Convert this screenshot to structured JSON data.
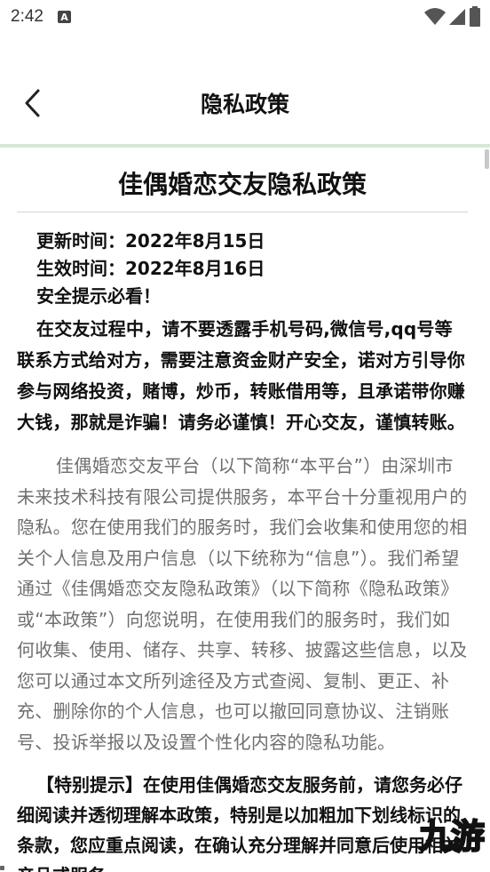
{
  "status_bar": {
    "time": "2:42",
    "notification_glyph": "A",
    "icons": [
      "wifi-icon",
      "signal-icon",
      "battery-icon"
    ]
  },
  "app_bar": {
    "title": "隐私政策",
    "back_icon": "chevron-left-icon"
  },
  "document": {
    "title": "佳偶婚恋交友隐私政策",
    "updated": "更新时间：2022年8月15日",
    "effective": "生效时间：2022年8月16日",
    "safety_header": "安全提示必看！",
    "warning": "在交友过程中，请不要透露手机号码,微信号,qq号等联系方式给对方，需要注意资金财产安全，诺对方引导你参与网络投资，赌博，炒币，转账借用等，且承诺带你赚大钱，那就是诈骗！请务必谨慎！开心交友，谨慎转账。",
    "intro": "佳偶婚恋交友平台（以下简称“本平台”）由深圳市未来技术科技有限公司提供服务，本平台十分重视用户的隐私。您在使用我们的服务时，我们会收集和使用您的相关个人信息及用户信息（以下统称为“信息”）。我们希望通过《佳偶婚恋交友隐私政策》（以下简称《隐私政策》或“本政策”）向您说明，在使用我们的服务时，我们如何收集、使用、储存、共享、转移、披露这些信息，以及您可以通过本文所列途径及方式查阅、复制、更正、补充、删除你的个人信息，也可以撤回同意协议、注销账号、投诉举报以及设置个性化内容的隐私功能。",
    "special_notice": "【特别提示】在使用佳偶婚恋交友服务前，请您务必仔细阅读并透彻理解本政策，特别是以加粗加下划线标识的条款，您应重点阅读，在确认充分理解并同意后使用相关产品或服务。"
  },
  "watermark": {
    "text": "九游"
  },
  "colors": {
    "divider_green": "#d3ead3",
    "body_gray": "#6f6f6f",
    "text_dark": "#111111"
  }
}
